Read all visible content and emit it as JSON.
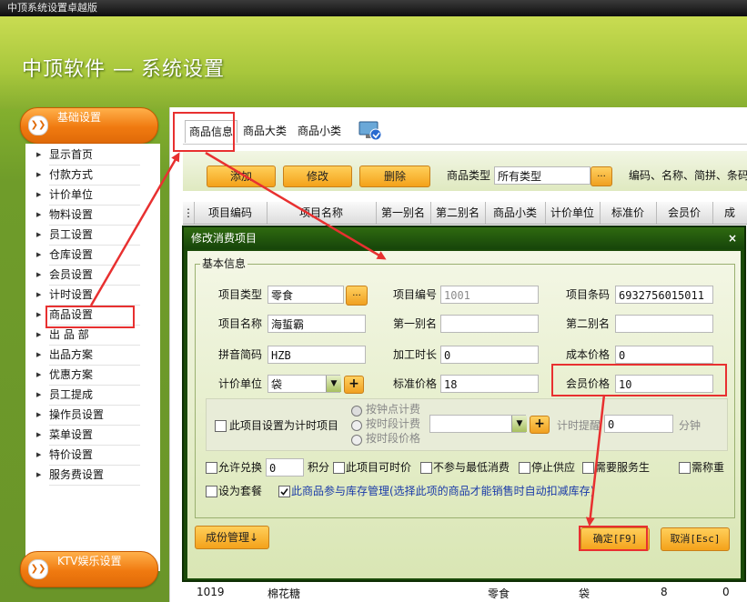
{
  "window_title": "中顶系统设置卓越版",
  "app_title": "中顶软件 — 系统设置",
  "sidebar": {
    "section1": "基础设置",
    "section2": "KTV娱乐设置",
    "items": [
      "显示首页",
      "付款方式",
      "计价单位",
      "物料设置",
      "员工设置",
      "仓库设置",
      "会员设置",
      "计时设置",
      "商品设置",
      "出 品 部",
      "出品方案",
      "优惠方案",
      "员工提成",
      "操作员设置",
      "菜单设置",
      "特价设置",
      "服务费设置"
    ]
  },
  "tabs": [
    "商品信息",
    "商品大类",
    "商品小类"
  ],
  "toolbar": {
    "add": "添加",
    "edit": "修改",
    "delete": "删除",
    "type_label": "商品类型",
    "type_value": "所有类型",
    "more": "...",
    "search_hint": "编码、名称、简拼、条码"
  },
  "grid_headers": [
    "项目编码",
    "项目名称",
    "第一别名",
    "第二别名",
    "商品小类",
    "计价单位",
    "标准价",
    "会员价",
    "成"
  ],
  "grid_row": {
    "code": "1019",
    "name": "棉花糖",
    "subcat": "零食",
    "unit": "袋",
    "std": "8",
    "member": "0"
  },
  "dialog": {
    "title": "修改消费项目",
    "close": "×",
    "group": "基本信息",
    "item_type_label": "项目类型",
    "item_type_value": "零食",
    "item_code_label": "项目编号",
    "item_code_value": "1001",
    "barcode_label": "项目条码",
    "barcode_value": "6932756015011",
    "name_label": "项目名称",
    "name_value": "海蜇霸",
    "alias1_label": "第一别名",
    "alias1_value": "",
    "alias2_label": "第二别名",
    "alias2_value": "",
    "pinyin_label": "拼音简码",
    "pinyin_value": "HZB",
    "process_label": "加工时长",
    "process_value": "0",
    "cost_label": "成本价格",
    "cost_value": "0",
    "unit_label": "计价单位",
    "unit_value": "袋",
    "std_price_label": "标准价格",
    "std_price_value": "18",
    "member_price_label": "会员价格",
    "member_price_value": "10",
    "timed_item_label": "此项目设置为计时项目",
    "radio1": "按钟点计费",
    "radio2": "按时段计费",
    "radio3": "按时段价格",
    "timer_remind_label": "计时提醒",
    "timer_remind_value": "0",
    "minutes": "分钟",
    "allow_exchange": "允许兑换",
    "points_value": "0",
    "points_label": "积分",
    "timed_price": "此项目可时价",
    "no_min_consume": "不参与最低消费",
    "stop_supply": "停止供应",
    "need_service": "需要服务生",
    "need_weigh": "需称重",
    "set_package": "设为套餐",
    "inventory_manage": "此商品参与库存管理(选择此项的商品才能销售时自动扣减库存)",
    "component_btn": "成份管理↓",
    "ok_btn": "确定[F9]",
    "cancel_btn": "取消[Esc]"
  },
  "colors": {
    "accent_orange": "#f07a10",
    "highlight_red": "#e83030",
    "dialog_green": "#1a4a08"
  }
}
